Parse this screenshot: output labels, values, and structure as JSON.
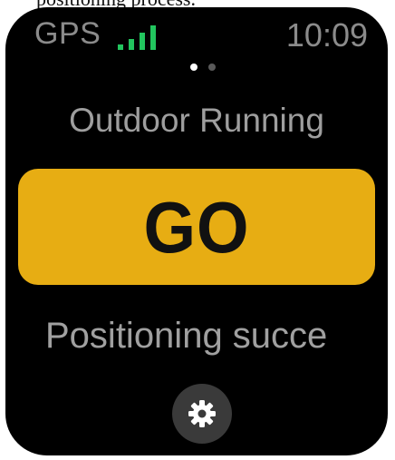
{
  "caption": {
    "partial_text": "positioning process."
  },
  "status_bar": {
    "gps_label": "GPS",
    "signal_icon": "signal-bars-icon",
    "signal_color": "#22c55e",
    "time": "10:09"
  },
  "pager": {
    "total": 2,
    "active_index": 0
  },
  "activity": {
    "title": "Outdoor Running"
  },
  "go_button": {
    "label": "GO",
    "color": "#e7ad13"
  },
  "status": {
    "text": "Positioning succe"
  },
  "settings_button": {
    "icon": "gear-icon"
  }
}
